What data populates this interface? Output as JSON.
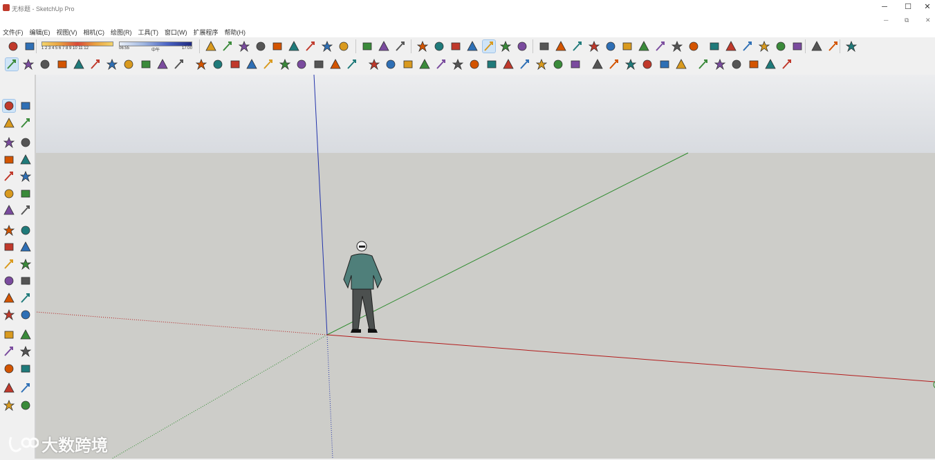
{
  "window": {
    "title": "无标题 - SketchUp Pro",
    "controls": [
      "─",
      "☐",
      "✕"
    ],
    "mdi_controls": [
      "─",
      "⧉",
      "✕"
    ]
  },
  "menu": [
    "文件(F)",
    "编辑(E)",
    "视图(V)",
    "相机(C)",
    "绘图(R)",
    "工具(T)",
    "窗口(W)",
    "扩展程序",
    "帮助(H)"
  ],
  "shadows": {
    "months": "1 2 3 4 5 6 7 8 9 10 11 12",
    "time_start": "06:55",
    "time_mid": "中午",
    "time_end": "17:00"
  },
  "toolbar_row1": [
    "shadows-toggle-icon",
    "fog-icon",
    "orbit-icon",
    "pan-icon",
    "zoom-icon",
    "zoom-window-icon",
    "zoom-extents-icon",
    "previous-view-icon",
    "position-camera-icon",
    "look-around-icon",
    "walk-icon",
    "axes-icon",
    "section-plane-icon",
    "display-section-icon",
    "styles-icon",
    "iso-view-icon",
    "top-view-icon",
    "front-view-icon",
    "right-view-icon",
    "back-view-icon",
    "left-view-icon",
    "xray-icon",
    "wireframe-icon",
    "hidden-line-icon",
    "shaded-icon",
    "textured-icon",
    "monochrome-icon",
    "sandbox-from-contours-icon",
    "sandbox-from-scratch-icon",
    "smoove-icon",
    "stamp-icon",
    "drape-icon",
    "add-detail-icon",
    "flip-edge-icon",
    "warehouse-icon",
    "share-model-icon",
    "extension-warehouse-icon",
    "bb-icon",
    "ruby-console-icon",
    "su-app-icon"
  ],
  "toolbar_row2": [
    "select-icon",
    "eraser-icon",
    "pencil-line-icon",
    "arc-icon",
    "circle-icon",
    "push-pull-icon",
    "follow-me-icon",
    "move-icon",
    "rotate-icon",
    "scale-icon",
    "tape-measure-icon",
    "text-icon",
    "paint-bucket-icon",
    "orbit-icon",
    "pan-icon",
    "zoom-icon",
    "zoom-extents-icon",
    "book-icon",
    "component-icon",
    "component-2-icon",
    "export-icon",
    "plugin-m-icon",
    "plugin-tag-icon",
    "plugin-r-icon",
    "plugin-rt-icon",
    "plugin-br-icon",
    "help-icon",
    "plugin-stamp-icon",
    "plugin-sphere-icon",
    "plugin-cross-icon",
    "plugin-tree-icon",
    "plugin-tree-2-icon",
    "plugin-target-icon",
    "plugin-pause-icon",
    "light-bulb-icon",
    "light-spot-icon",
    "light-flag-icon",
    "light-dome-icon",
    "light-dot-icon",
    "light-star-icon",
    "3d-box-icon",
    "door-icon",
    "house-icon",
    "house-2-icon",
    "house-outline-icon",
    "store-icon"
  ],
  "left_tools": [
    [
      "select-icon",
      "make-component-icon"
    ],
    [
      "paint-bucket-icon",
      "eraser-icon"
    ],
    [
      "line-icon",
      "freehand-icon"
    ],
    [
      "rectangle-icon",
      "rotated-rect-icon"
    ],
    [
      "circle-icon",
      "polygon-icon"
    ],
    [
      "arc-icon",
      "two-point-arc-icon"
    ],
    [
      "three-point-arc-icon",
      "pie-icon"
    ],
    [
      "move-icon",
      "push-pull-icon"
    ],
    [
      "rotate-icon",
      "follow-me-icon"
    ],
    [
      "scale-icon",
      "offset-icon"
    ],
    [
      "tape-measure-icon",
      "dimension-icon"
    ],
    [
      "protractor-icon",
      "text-icon"
    ],
    [
      "axes-icon",
      "3d-text-icon"
    ],
    [
      "orbit-icon",
      "pan-icon"
    ],
    [
      "zoom-icon",
      "zoom-window-icon"
    ],
    [
      "zoom-extents-icon",
      "previous-icon"
    ],
    [
      "position-camera-icon",
      "look-around-icon"
    ],
    [
      "walk-icon",
      "section-plane-icon"
    ]
  ],
  "watermark": "大数跨境",
  "colors": {
    "sky_top": "#ecedef",
    "sky_bottom": "#d9dde2",
    "ground": "#cdcdc9",
    "axis_red": "#b31b1b",
    "axis_green": "#2e8b2e",
    "axis_blue": "#2233aa",
    "selected_tool": "#cfe4f7"
  }
}
